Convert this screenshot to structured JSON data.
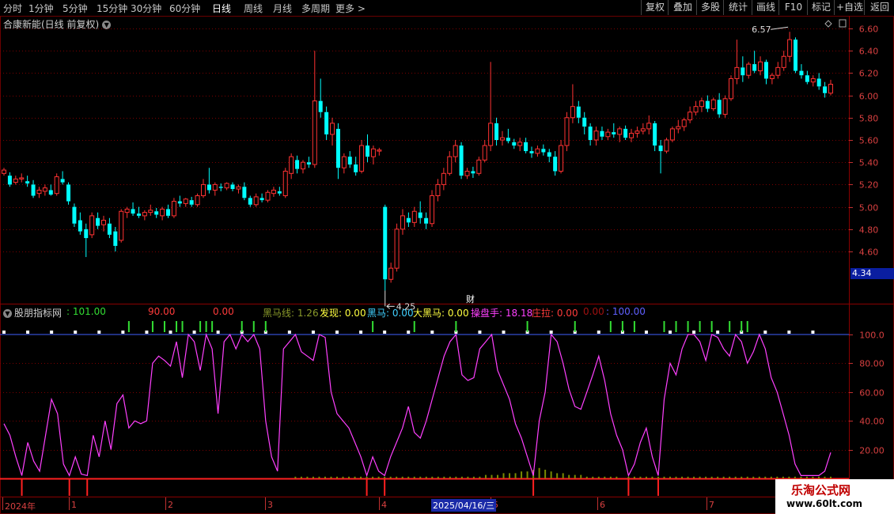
{
  "toolbar": {
    "periods": [
      "分时",
      "1分钟",
      "5分钟",
      "15分钟",
      "30分钟",
      "60分钟",
      "日线",
      "周线",
      "月线",
      "多周期",
      "更多 >"
    ],
    "active_period": "日线",
    "right_buttons": [
      "复权",
      "叠加",
      "多股",
      "统计",
      "画线",
      "F10",
      "标记",
      "+自选",
      "返回"
    ]
  },
  "stock": {
    "title": "合康新能(日线 前复权)"
  },
  "indicator": {
    "name": "股朋指标网",
    "values": [
      {
        "label": "",
        "value": ": 101.00",
        "color": "#33dd33"
      },
      {
        "label": "",
        "value": "90.00",
        "color": "#ff3b3b"
      },
      {
        "label": "",
        "value": "0.00",
        "color": "#ff3b3b"
      },
      {
        "label": "黑马线",
        "value": ": 1.26",
        "color": "#8a9a2a"
      },
      {
        "label": "发现",
        "value": ": 0.00",
        "color": "#ffff40"
      },
      {
        "label": "黑马",
        "value": ": 0.00",
        "color": "#40d0ff"
      },
      {
        "label": "大黑马",
        "value": ": 0.00",
        "color": "#ffff40"
      },
      {
        "label": "操盘手",
        "value": ": 18.18",
        "color": "#ff40ff"
      },
      {
        "label": "庄拉",
        "value": ": 0.00",
        "color": "#ff3b3b"
      },
      {
        "label": "",
        "value": "0.00",
        "color": "#a01010"
      },
      {
        "label": "",
        "value": ": 100.00",
        "color": "#6060ff"
      }
    ]
  },
  "cursor": {
    "date": "2025/04/16/三",
    "price": "4.34"
  },
  "markers": {
    "cai": "财"
  },
  "date_axis": [
    "2024年",
    "1",
    "2",
    "3",
    "4",
    "5",
    "6",
    "7"
  ],
  "watermark": {
    "line1": "乐淘公式网",
    "line2": "www.60lt.com"
  },
  "colors": {
    "up": "#ff3232",
    "down": "#00ffff",
    "osc": "#ff40ff",
    "ref_line": "#4060ff",
    "signal": "#33dd33",
    "volume": "#7a8a00"
  },
  "chart_data": [
    {
      "type": "candlestick",
      "title": "合康新能(日线 前复权)",
      "y_ticks": [
        "6.60",
        "6.40",
        "6.20",
        "6.00",
        "5.80",
        "5.60",
        "5.40",
        "5.20",
        "5.00",
        "4.80",
        "4.60"
      ],
      "ylim": [
        4.34,
        6.66
      ],
      "annotations": [
        {
          "text": "6.57",
          "kind": "high"
        },
        {
          "text": "4.25",
          "kind": "low"
        }
      ],
      "ohlc": [
        [
          5.3,
          5.35,
          5.28,
          5.33
        ],
        [
          5.28,
          5.31,
          5.18,
          5.2
        ],
        [
          5.22,
          5.28,
          5.2,
          5.25
        ],
        [
          5.25,
          5.3,
          5.22,
          5.26
        ],
        [
          5.23,
          5.28,
          5.18,
          5.21
        ],
        [
          5.2,
          5.24,
          5.08,
          5.1
        ],
        [
          5.12,
          5.18,
          5.08,
          5.15
        ],
        [
          5.14,
          5.2,
          5.1,
          5.17
        ],
        [
          5.15,
          5.2,
          5.1,
          5.11
        ],
        [
          5.12,
          5.3,
          5.1,
          5.27
        ],
        [
          5.25,
          5.32,
          5.2,
          5.22
        ],
        [
          5.2,
          5.22,
          5.02,
          5.05
        ],
        [
          5.0,
          5.03,
          4.82,
          4.85
        ],
        [
          4.88,
          4.95,
          4.75,
          4.78
        ],
        [
          4.8,
          4.85,
          4.55,
          4.72
        ],
        [
          4.75,
          4.95,
          4.72,
          4.92
        ],
        [
          4.9,
          4.95,
          4.8,
          4.83
        ],
        [
          4.84,
          4.92,
          4.78,
          4.88
        ],
        [
          4.85,
          4.9,
          4.72,
          4.75
        ],
        [
          4.78,
          4.82,
          4.6,
          4.65
        ],
        [
          4.7,
          4.98,
          4.68,
          4.96
        ],
        [
          4.95,
          5.0,
          4.9,
          4.98
        ],
        [
          4.98,
          5.04,
          4.92,
          4.94
        ],
        [
          4.94,
          5.0,
          4.9,
          4.92
        ],
        [
          4.92,
          4.97,
          4.88,
          4.95
        ],
        [
          4.95,
          5.02,
          4.92,
          4.97
        ],
        [
          4.96,
          4.99,
          4.9,
          4.93
        ],
        [
          4.92,
          5.0,
          4.88,
          4.98
        ],
        [
          4.98,
          5.02,
          4.9,
          4.92
        ],
        [
          4.92,
          5.08,
          4.9,
          5.05
        ],
        [
          5.05,
          5.1,
          5.0,
          5.03
        ],
        [
          5.03,
          5.08,
          5.0,
          5.07
        ],
        [
          5.06,
          5.09,
          5.0,
          5.02
        ],
        [
          5.02,
          5.12,
          5.0,
          5.1
        ],
        [
          5.1,
          5.25,
          5.08,
          5.2
        ],
        [
          5.2,
          5.35,
          5.12,
          5.15
        ],
        [
          5.15,
          5.22,
          5.1,
          5.2
        ],
        [
          5.18,
          5.21,
          5.14,
          5.17
        ],
        [
          5.17,
          5.22,
          5.15,
          5.21
        ],
        [
          5.2,
          5.22,
          5.14,
          5.16
        ],
        [
          5.16,
          5.2,
          5.12,
          5.18
        ],
        [
          5.18,
          5.22,
          5.06,
          5.08
        ],
        [
          5.08,
          5.1,
          5.0,
          5.02
        ],
        [
          5.02,
          5.12,
          5.0,
          5.09
        ],
        [
          5.08,
          5.12,
          5.04,
          5.06
        ],
        [
          5.06,
          5.15,
          5.04,
          5.13
        ],
        [
          5.12,
          5.18,
          5.09,
          5.15
        ],
        [
          5.14,
          5.18,
          5.1,
          5.12
        ],
        [
          5.1,
          5.35,
          5.08,
          5.32
        ],
        [
          5.3,
          5.48,
          5.25,
          5.45
        ],
        [
          5.42,
          5.46,
          5.3,
          5.34
        ],
        [
          5.34,
          5.42,
          5.3,
          5.4
        ],
        [
          5.4,
          5.45,
          5.35,
          5.38
        ],
        [
          5.38,
          6.4,
          5.35,
          5.95
        ],
        [
          5.95,
          6.15,
          5.8,
          5.85
        ],
        [
          5.85,
          5.9,
          5.6,
          5.65
        ],
        [
          5.65,
          5.8,
          5.55,
          5.75
        ],
        [
          5.7,
          5.75,
          5.25,
          5.35
        ],
        [
          5.35,
          5.48,
          5.3,
          5.45
        ],
        [
          5.45,
          5.5,
          5.35,
          5.38
        ],
        [
          5.38,
          5.45,
          5.28,
          5.31
        ],
        [
          5.32,
          5.6,
          5.3,
          5.55
        ],
        [
          5.55,
          5.65,
          5.4,
          5.45
        ],
        [
          5.45,
          5.55,
          5.38,
          5.52
        ],
        [
          5.5,
          5.53,
          5.46,
          5.51
        ],
        [
          5.0,
          5.02,
          4.25,
          4.35
        ],
        [
          4.35,
          4.5,
          4.32,
          4.45
        ],
        [
          4.45,
          4.85,
          4.42,
          4.8
        ],
        [
          4.8,
          4.98,
          4.75,
          4.92
        ],
        [
          4.9,
          4.95,
          4.82,
          4.86
        ],
        [
          4.86,
          5.0,
          4.82,
          4.96
        ],
        [
          4.95,
          5.05,
          4.85,
          4.9
        ],
        [
          4.9,
          4.95,
          4.8,
          4.85
        ],
        [
          4.85,
          5.15,
          4.82,
          5.1
        ],
        [
          5.1,
          5.25,
          5.05,
          5.2
        ],
        [
          5.2,
          5.35,
          5.15,
          5.3
        ],
        [
          5.3,
          5.5,
          5.28,
          5.45
        ],
        [
          5.45,
          5.6,
          5.4,
          5.55
        ],
        [
          5.55,
          5.58,
          5.25,
          5.28
        ],
        [
          5.28,
          5.35,
          5.25,
          5.32
        ],
        [
          5.32,
          5.36,
          5.26,
          5.3
        ],
        [
          5.3,
          5.45,
          5.28,
          5.42
        ],
        [
          5.42,
          5.6,
          5.4,
          5.55
        ],
        [
          5.55,
          6.3,
          5.5,
          5.75
        ],
        [
          5.75,
          5.8,
          5.55,
          5.6
        ],
        [
          5.6,
          5.68,
          5.55,
          5.62
        ],
        [
          5.62,
          5.7,
          5.57,
          5.59
        ],
        [
          5.58,
          5.61,
          5.52,
          5.55
        ],
        [
          5.55,
          5.62,
          5.5,
          5.58
        ],
        [
          5.58,
          5.62,
          5.48,
          5.5
        ],
        [
          5.5,
          5.54,
          5.44,
          5.48
        ],
        [
          5.48,
          5.55,
          5.45,
          5.52
        ],
        [
          5.52,
          5.56,
          5.46,
          5.49
        ],
        [
          5.49,
          5.52,
          5.4,
          5.45
        ],
        [
          5.45,
          5.5,
          5.28,
          5.32
        ],
        [
          5.32,
          5.6,
          5.3,
          5.55
        ],
        [
          5.55,
          5.85,
          5.5,
          5.8
        ],
        [
          5.8,
          6.1,
          5.75,
          5.9
        ],
        [
          5.9,
          5.95,
          5.75,
          5.8
        ],
        [
          5.8,
          5.85,
          5.65,
          5.72
        ],
        [
          5.72,
          5.75,
          5.55,
          5.6
        ],
        [
          5.6,
          5.72,
          5.55,
          5.68
        ],
        [
          5.68,
          5.72,
          5.6,
          5.63
        ],
        [
          5.63,
          5.7,
          5.6,
          5.67
        ],
        [
          5.67,
          5.75,
          5.62,
          5.65
        ],
        [
          5.65,
          5.72,
          5.58,
          5.7
        ],
        [
          5.7,
          5.73,
          5.6,
          5.62
        ],
        [
          5.62,
          5.7,
          5.58,
          5.66
        ],
        [
          5.66,
          5.72,
          5.62,
          5.68
        ],
        [
          5.68,
          5.75,
          5.65,
          5.7
        ],
        [
          5.7,
          5.82,
          5.65,
          5.75
        ],
        [
          5.75,
          5.77,
          5.5,
          5.55
        ],
        [
          5.55,
          5.6,
          5.3,
          5.5
        ],
        [
          5.5,
          5.62,
          5.48,
          5.6
        ],
        [
          5.6,
          5.72,
          5.58,
          5.7
        ],
        [
          5.7,
          5.78,
          5.66,
          5.72
        ],
        [
          5.72,
          5.8,
          5.68,
          5.78
        ],
        [
          5.78,
          5.9,
          5.75,
          5.85
        ],
        [
          5.85,
          5.95,
          5.82,
          5.9
        ],
        [
          5.9,
          5.98,
          5.85,
          5.95
        ],
        [
          5.95,
          6.0,
          5.85,
          5.88
        ],
        [
          5.88,
          5.98,
          5.86,
          5.96
        ],
        [
          5.96,
          6.02,
          5.8,
          5.83
        ],
        [
          5.83,
          6.0,
          5.8,
          5.97
        ],
        [
          5.97,
          6.18,
          5.95,
          6.15
        ],
        [
          6.15,
          6.5,
          6.1,
          6.25
        ],
        [
          6.25,
          6.35,
          6.12,
          6.18
        ],
        [
          6.18,
          6.3,
          6.15,
          6.28
        ],
        [
          6.28,
          6.4,
          6.2,
          6.22
        ],
        [
          6.22,
          6.35,
          6.18,
          6.3
        ],
        [
          6.3,
          6.32,
          6.1,
          6.15
        ],
        [
          6.15,
          6.2,
          6.1,
          6.18
        ],
        [
          6.18,
          6.3,
          6.15,
          6.25
        ],
        [
          6.25,
          6.4,
          6.22,
          6.35
        ],
        [
          6.35,
          6.57,
          6.3,
          6.5
        ],
        [
          6.5,
          6.52,
          6.2,
          6.22
        ],
        [
          6.22,
          6.28,
          6.15,
          6.18
        ],
        [
          6.18,
          6.22,
          6.1,
          6.12
        ],
        [
          6.12,
          6.18,
          6.08,
          6.15
        ],
        [
          6.15,
          6.2,
          6.05,
          6.08
        ],
        [
          6.08,
          6.12,
          5.98,
          6.02
        ],
        [
          6.02,
          6.14,
          6.0,
          6.1
        ]
      ]
    },
    {
      "type": "line",
      "name": "操盘手",
      "y_ticks": [
        "100.0",
        "80.00",
        "60.00",
        "40.00",
        "20.00"
      ],
      "ylim": [
        -0.5,
        100
      ],
      "ref_line": 100,
      "values": [
        38,
        30,
        15,
        2,
        25,
        12,
        5,
        30,
        55,
        45,
        10,
        2,
        15,
        3,
        2,
        30,
        15,
        40,
        20,
        52,
        58,
        35,
        40,
        38,
        40,
        80,
        85,
        82,
        78,
        95,
        70,
        100,
        95,
        75,
        100,
        90,
        45,
        95,
        100,
        90,
        100,
        95,
        100,
        90,
        40,
        15,
        5,
        90,
        95,
        100,
        88,
        85,
        82,
        100,
        98,
        60,
        45,
        40,
        35,
        25,
        15,
        2,
        15,
        5,
        2,
        15,
        25,
        35,
        50,
        32,
        28,
        40,
        55,
        70,
        85,
        95,
        100,
        72,
        68,
        70,
        90,
        95,
        100,
        75,
        65,
        55,
        38,
        28,
        15,
        2,
        40,
        60,
        100,
        95,
        80,
        62,
        50,
        48,
        60,
        72,
        85,
        68,
        45,
        30,
        20,
        2,
        10,
        25,
        35,
        15,
        2,
        55,
        80,
        72,
        90,
        100,
        100,
        95,
        82,
        100,
        98,
        90,
        85,
        100,
        95,
        80,
        88,
        100,
        90,
        70,
        60,
        45,
        30,
        10,
        2,
        2,
        2,
        2,
        5,
        18
      ],
      "signals": [
        0,
        0,
        0,
        0,
        0,
        0,
        0,
        0,
        0,
        0,
        0,
        0,
        0,
        0,
        0,
        0,
        0,
        0,
        0,
        0,
        0,
        0,
        0,
        0,
        0,
        0,
        0,
        0,
        0,
        0,
        0,
        0,
        0,
        0,
        0,
        0,
        0,
        0,
        0,
        0,
        0,
        0,
        0,
        0,
        0,
        0,
        0,
        0,
        0,
        0,
        0,
        0,
        0,
        0,
        0,
        0,
        0,
        0,
        0,
        0,
        0,
        0,
        0,
        0,
        0,
        0,
        0,
        0,
        0,
        0,
        0,
        0,
        0,
        0,
        0,
        0,
        0,
        0,
        0,
        0,
        0,
        0,
        0,
        0,
        0,
        0,
        0,
        0,
        0,
        0,
        0,
        0,
        0,
        0,
        0,
        0,
        0,
        0,
        0,
        0,
        0,
        0,
        0,
        0,
        0,
        0,
        0,
        0,
        0,
        0,
        0,
        0,
        0,
        0,
        0,
        0,
        0,
        0,
        0,
        0,
        0,
        0,
        0,
        0,
        0,
        0,
        0,
        0,
        0,
        0,
        0,
        0,
        0,
        0,
        0,
        0,
        0,
        0,
        0,
        0
      ],
      "signal_bars": [
        21,
        25,
        27,
        29,
        30,
        33,
        34,
        35,
        40,
        42,
        44,
        62,
        69,
        76,
        88,
        96,
        102,
        104,
        106,
        111,
        113,
        115,
        117,
        119,
        122,
        124,
        125
      ],
      "volume_like": [
        0,
        0,
        0,
        0,
        0,
        0,
        0,
        0,
        0,
        0,
        0,
        0,
        0,
        0,
        0,
        0,
        0,
        0,
        0,
        0,
        0,
        0,
        0,
        0,
        0,
        0,
        0,
        0,
        0,
        0,
        0,
        0,
        0,
        0,
        0,
        0,
        0,
        0,
        0,
        0,
        0,
        0,
        0,
        0,
        0,
        0,
        0,
        0,
        0,
        1,
        1,
        1,
        1,
        1,
        1,
        1,
        1,
        1,
        1,
        1,
        1,
        1,
        1,
        1,
        1,
        1,
        1,
        1,
        1,
        1,
        1,
        1,
        1,
        1,
        1,
        1,
        1,
        1,
        1,
        1,
        1,
        2,
        2,
        2,
        3,
        3,
        3,
        4,
        4,
        5,
        6,
        5,
        4,
        3,
        3,
        2,
        2,
        2,
        1,
        1,
        1,
        1,
        1,
        1,
        0,
        1,
        1,
        1,
        1,
        1,
        1,
        1,
        1,
        1,
        1,
        1,
        1,
        1,
        1,
        1,
        1,
        1,
        1,
        1,
        1,
        1,
        1,
        1,
        1,
        1,
        1,
        1,
        1,
        1,
        1,
        1,
        1,
        1,
        1,
        1
      ]
    }
  ]
}
